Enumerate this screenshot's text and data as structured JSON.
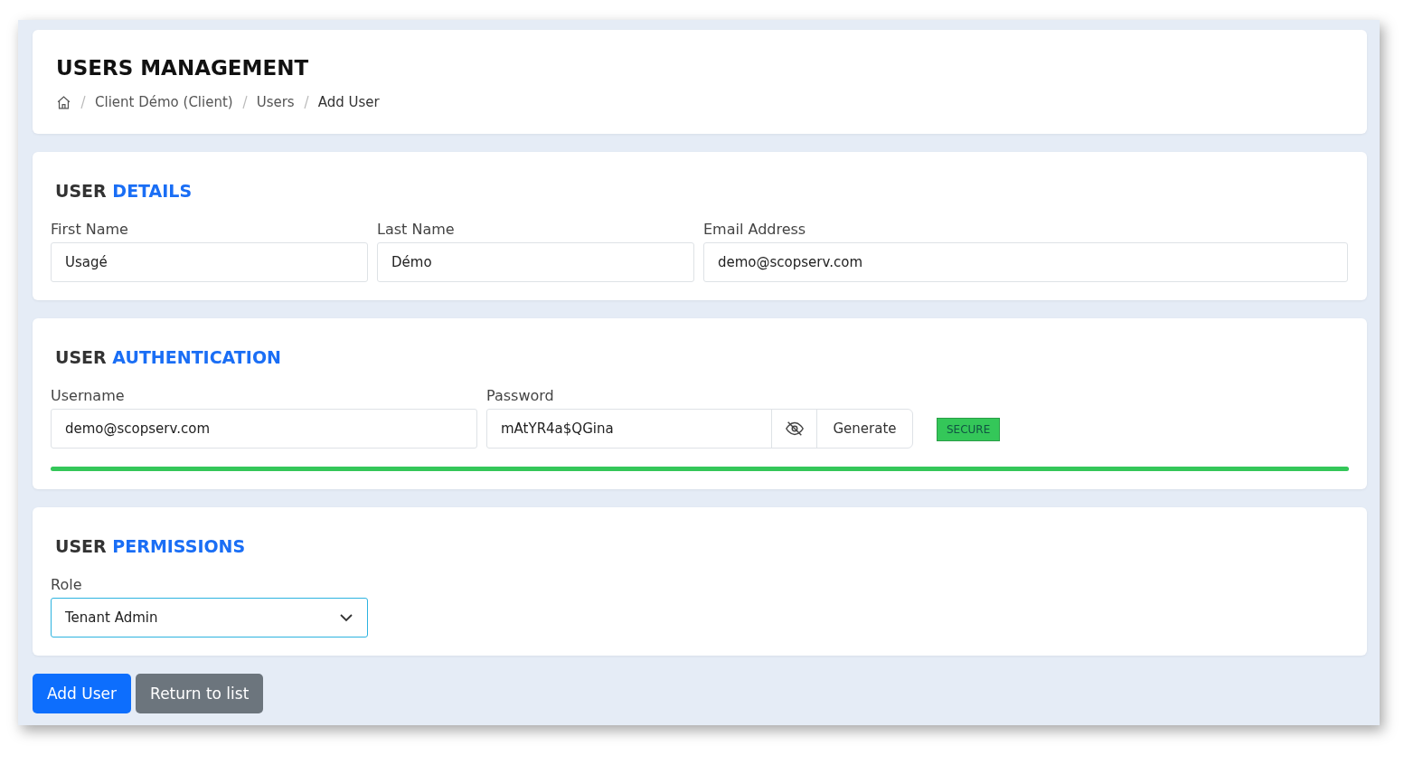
{
  "header": {
    "title": "USERS MANAGEMENT",
    "breadcrumb": [
      "Client Démo (Client)",
      "Users",
      "Add User"
    ]
  },
  "details": {
    "title_lead": "USER",
    "title_accent": "DETAILS",
    "fields": [
      {
        "label": "First Name",
        "value": "Usagé"
      },
      {
        "label": "Last Name",
        "value": "Démo"
      },
      {
        "label": "Email Address",
        "value": "demo@scopserv.com"
      }
    ]
  },
  "authentication": {
    "title_lead": "USER",
    "title_accent": "AUTHENTICATION",
    "username": {
      "label": "Username",
      "value": "demo@scopserv.com"
    },
    "password": {
      "label": "Password",
      "value": "mAtYR4a$QGina",
      "generate": "Generate",
      "strength_badge": "SECURE",
      "strength": {
        "level": 1,
        "color": "#34c759"
      }
    }
  },
  "permissions": {
    "title_lead": "USER",
    "title_accent": "PERMISSIONS",
    "role": {
      "label": "Role",
      "value": "Tenant Admin"
    }
  },
  "buttons": [
    {
      "label": "Add User",
      "kind": "primary"
    },
    {
      "label": "Return to list",
      "kind": "secondary"
    }
  ]
}
